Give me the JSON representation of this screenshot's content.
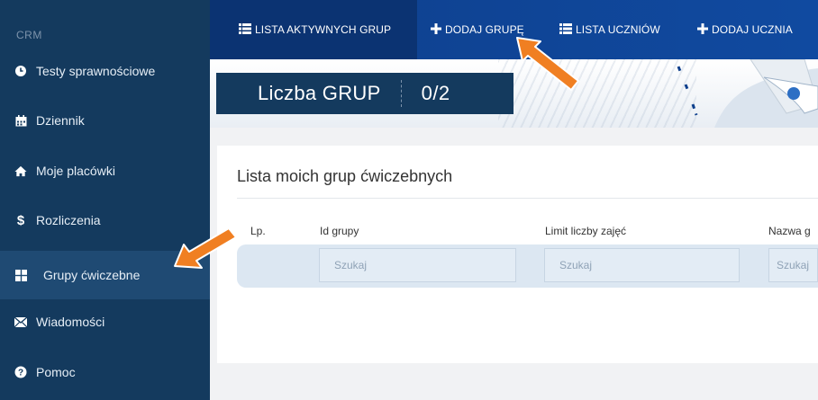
{
  "sidebar": {
    "brand": "CRM",
    "items": [
      {
        "label": "Testy sprawnościowe",
        "icon": "clock-icon"
      },
      {
        "label": "Dziennik",
        "icon": "calendar-icon"
      },
      {
        "label": "Moje placówki",
        "icon": "home-icon"
      },
      {
        "label": "Rozliczenia",
        "icon": "dollar-icon"
      },
      {
        "label": "Grupy ćwiczebne",
        "icon": "grid-icon"
      },
      {
        "label": "Wiadomości",
        "icon": "envelope-icon"
      },
      {
        "label": "Pomoc",
        "icon": "question-icon"
      }
    ]
  },
  "topnav": {
    "tabs": [
      {
        "label": "LISTA AKTYWNYCH GRUP",
        "icon": "list-icon"
      },
      {
        "label": "DODAJ GRUPĘ",
        "icon": "plus-icon"
      },
      {
        "label": "LISTA UCZNIÓW",
        "icon": "list-icon"
      },
      {
        "label": "DODAJ UCZNIA",
        "icon": "plus-icon"
      }
    ]
  },
  "counter": {
    "label": "Liczba GRUP",
    "value": "0/2"
  },
  "main": {
    "title": "Lista moich grup ćwiczebnych",
    "columns": [
      "Lp.",
      "Id grupy",
      "Limit liczby zajęć",
      "Nazwa g"
    ],
    "filter_placeholder": "Szukaj",
    "filter_placeholder_cut": "Szukaj"
  },
  "colors": {
    "sidebar": "#143a5e",
    "topnav": "#0e3f8c",
    "arrow": "#f07f22"
  }
}
